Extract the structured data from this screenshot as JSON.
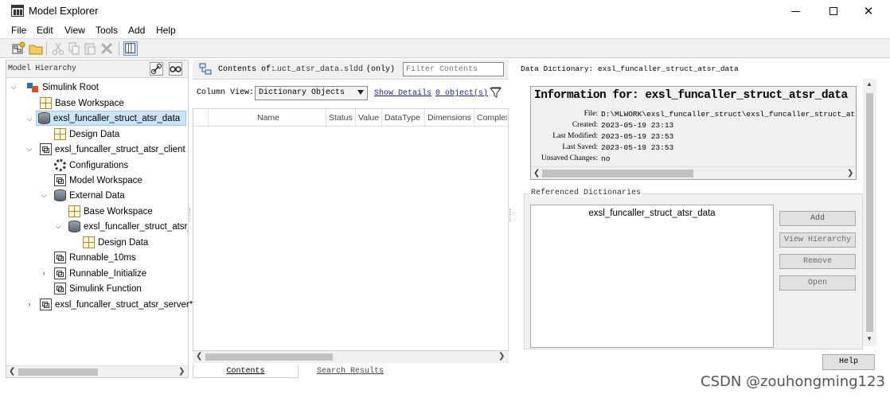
{
  "window": {
    "title": "Model Explorer"
  },
  "menu": [
    {
      "label": "File"
    },
    {
      "label": "Edit"
    },
    {
      "label": "View"
    },
    {
      "label": "Tools"
    },
    {
      "label": "Add"
    },
    {
      "label": "Help"
    }
  ],
  "toolbar": {
    "icons": [
      "new-model-icon",
      "open-folder-icon",
      "cut-icon",
      "copy-icon",
      "paste-icon",
      "delete-icon",
      "show-dialog-pane-icon"
    ]
  },
  "hierarchy": {
    "title": "Model Hierarchy",
    "items": [
      {
        "label": "Simulink Root",
        "icon": "simulink-root-icon"
      },
      {
        "label": "Base Workspace",
        "icon": "workspace-icon"
      },
      {
        "label": "exsl_funcaller_struct_atsr_data",
        "icon": "data-dictionary-icon"
      },
      {
        "label": "Design Data",
        "icon": "workspace-icon"
      },
      {
        "label": "exsl_funcaller_struct_atsr_client",
        "icon": "model-icon"
      },
      {
        "label": "Configurations",
        "icon": "gear-icon"
      },
      {
        "label": "Model Workspace",
        "icon": "workspace-icon"
      },
      {
        "label": "External Data",
        "icon": "data-dictionary-icon"
      },
      {
        "label": "Base Workspace",
        "icon": "workspace-icon"
      },
      {
        "label": "exsl_funcaller_struct_atsr_d",
        "icon": "data-dictionary-icon"
      },
      {
        "label": "Design Data",
        "icon": "workspace-icon"
      },
      {
        "label": "Runnable_10ms",
        "icon": "subsystem-icon"
      },
      {
        "label": "Runnable_Initialize",
        "icon": "subsystem-icon"
      },
      {
        "label": "Simulink Function",
        "icon": "subsystem-icon"
      },
      {
        "label": "exsl_funcaller_struct_atsr_server*",
        "icon": "model-icon"
      }
    ]
  },
  "contents": {
    "label": "Contents of:",
    "file": "…uct_atsr_data.sldd",
    "scope": "(only)",
    "filter_placeholder": "Filter Contents",
    "column_view_label": "Column View:",
    "column_view_value": "Dictionary Objects",
    "show_details": "Show Details",
    "object_count": "0 object(s)",
    "columns": [
      "Name",
      "Status",
      "Value",
      "DataType",
      "Dimensions",
      "Complex"
    ],
    "tabs": [
      "Contents",
      "Search Results"
    ]
  },
  "dictionary": {
    "title": "Data Dictionary: exsl_funcaller_struct_atsr_data",
    "heading": "Information for: exsl_funcaller_struct_atsr_data",
    "fields": [
      {
        "key": "File:",
        "value": "D:\\MLWORK\\exsl_funcaller_struct\\exsl_funcaller_struct_atsr_data.sldd"
      },
      {
        "key": "Created:",
        "value": "2023-05-19 23:13"
      },
      {
        "key": "Last Modified:",
        "value": "2023-05-19 23:53"
      },
      {
        "key": "Last Saved:",
        "value": "2023-05-19 23:53"
      },
      {
        "key": "Unsaved Changes:",
        "value": "no"
      }
    ],
    "referenced_title": "Referenced Dictionaries",
    "referenced_items": [
      "exsl_funcaller_struct_atsr_data"
    ],
    "buttons": {
      "add": "Add",
      "view_hierarchy": "View Hierarchy",
      "remove": "Remove",
      "open": "Open"
    },
    "help": "Help"
  },
  "watermark": "CSDN @zouhongming123"
}
